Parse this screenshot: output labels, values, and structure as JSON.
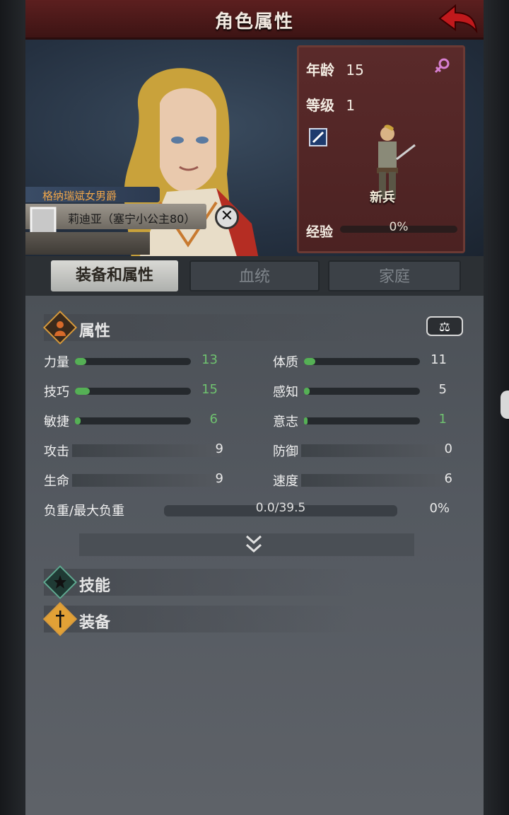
{
  "header": {
    "title": "角色属性"
  },
  "character": {
    "title": "格纳瑞斌女男爵",
    "name": "莉迪亚（塞宁小公主80）"
  },
  "unit": {
    "age_label": "年龄",
    "age": "15",
    "level_label": "等级",
    "level": "1",
    "unit_type": "新兵",
    "xp_label": "经验",
    "xp_value": "0%",
    "xp_fraction": 0
  },
  "tabs": [
    {
      "label": "装备和属性",
      "active": true
    },
    {
      "label": "血统",
      "active": false
    },
    {
      "label": "家庭",
      "active": false
    }
  ],
  "sections": {
    "attributes": "属性",
    "skills": "技能",
    "equipment": "装备"
  },
  "stats_left": [
    {
      "label": "力量",
      "value": "13",
      "fill": 0.1
    },
    {
      "label": "技巧",
      "value": "15",
      "fill": 0.13
    },
    {
      "label": "敏捷",
      "value": "6",
      "fill": 0.05
    }
  ],
  "stats_right": [
    {
      "label": "体质",
      "value": "11",
      "fill": 0.1
    },
    {
      "label": "感知",
      "value": "5",
      "fill": 0.05
    },
    {
      "label": "意志",
      "value": "1",
      "fill": 0.0
    }
  ],
  "combat_left": [
    {
      "label": "攻击",
      "value": "9"
    },
    {
      "label": "生命",
      "value": "9"
    }
  ],
  "combat_right": [
    {
      "label": "防御",
      "value": "0"
    },
    {
      "label": "速度",
      "value": "6"
    }
  ],
  "load": {
    "label": "负重/最大负重",
    "value": "0.0/39.5",
    "percent": "0%"
  },
  "colors": {
    "header_red": "#5c1f1f",
    "bar_green": "#55b055",
    "title_orange": "#f0a64a"
  }
}
